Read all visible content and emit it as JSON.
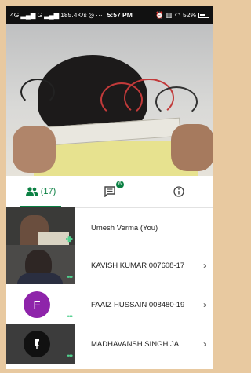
{
  "status": {
    "network_left": "4G",
    "network_mid": "G",
    "speed": "185.4K/s",
    "extra": "···",
    "time": "5:57 PM",
    "battery_text": "52%"
  },
  "tabs": {
    "people_count": "(17)",
    "chat_badge": "6"
  },
  "participants": [
    {
      "name": "Umesh Verma (You)"
    },
    {
      "name": "KAVISH KUMAR 007608-17"
    },
    {
      "name": "FAAIZ HUSSAIN 008480-19",
      "initial": "F"
    },
    {
      "name": "MADHAVANSH SINGH JA..."
    }
  ],
  "colors": {
    "accent": "#0b8043",
    "avatar_purple": "#8e24aa"
  }
}
